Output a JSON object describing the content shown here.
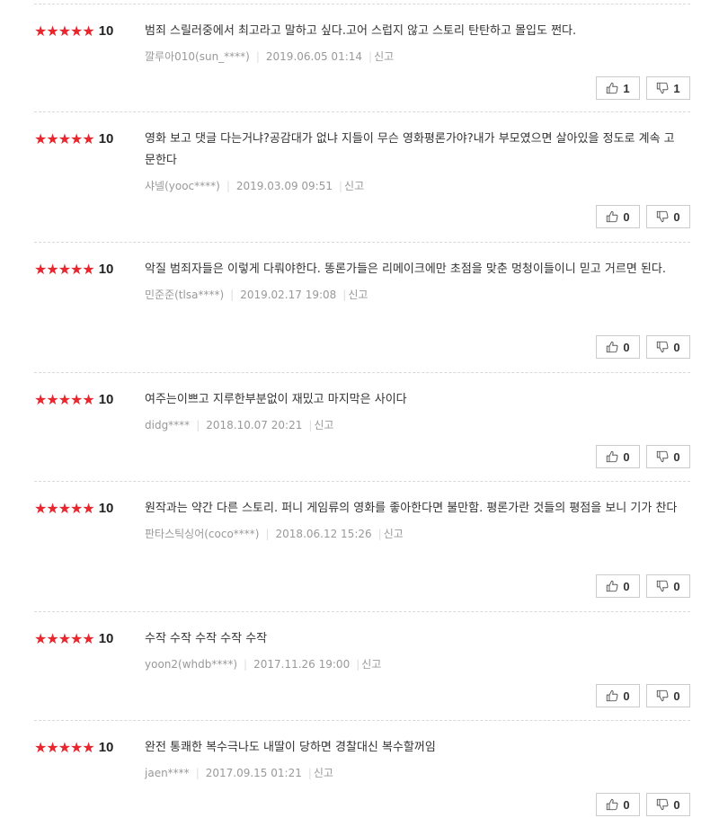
{
  "reviews": [
    {
      "stars": "★★★★★",
      "score": "10",
      "text": "범죄 스릴러중에서 최고라고 말하고 싶다.고어 스럽지 않고 스토리 탄탄하고 몰입도 쩐다.",
      "author": "깔루아010(sun_****)",
      "date": "2019.06.05 01:14",
      "report": "신고",
      "likes": "1",
      "dislikes": "1"
    },
    {
      "stars": "★★★★★",
      "score": "10",
      "text": "영화 보고 댓글 다는거냐?공감대가 없냐 지들이 무슨 영화평론가야?내가 부모였으면 살아있을 정도로 계속 고문한다",
      "author": "샤넬(yooc****)",
      "date": "2019.03.09 09:51",
      "report": "신고",
      "likes": "0",
      "dislikes": "0"
    },
    {
      "stars": "★★★★★",
      "score": "10",
      "text": "악질 범죄자들은 이렇게 다뤄야한다. 똥론가들은 리메이크에만 초점을 맞춘 멍청이들이니 믿고 거르면 된다.",
      "author": "민준준(tlsa****)",
      "date": "2019.02.17 19:08",
      "report": "신고",
      "likes": "0",
      "dislikes": "0"
    },
    {
      "stars": "★★★★★",
      "score": "10",
      "text": "여주는이쁘고 지루한부분없이 재밌고 마지막은 사이다",
      "author": "didg****",
      "date": "2018.10.07 20:21",
      "report": "신고",
      "likes": "0",
      "dislikes": "0"
    },
    {
      "stars": "★★★★★",
      "score": "10",
      "text": "원작과는 약간 다른 스토리. 퍼니 게임류의 영화를 좋아한다면 불만함. 평론가란 것들의 평점을 보니 기가 찬다",
      "author": "판타스틱싱어(coco****)",
      "date": "2018.06.12 15:26",
      "report": "신고",
      "likes": "0",
      "dislikes": "0"
    },
    {
      "stars": "★★★★★",
      "score": "10",
      "text": "수작 수작 수작 수작 수작",
      "author": "yoon2(whdb****)",
      "date": "2017.11.26 19:00",
      "report": "신고",
      "likes": "0",
      "dislikes": "0"
    },
    {
      "stars": "★★★★★",
      "score": "10",
      "text": "완전 통쾌한 복수극나도 내딸이 당하면 경찰대신 복수할꺼임",
      "author": "jaen****",
      "date": "2017.09.15 01:21",
      "report": "신고",
      "likes": "0",
      "dislikes": "0"
    }
  ],
  "icons": {
    "like": "thumbs-up-icon",
    "dislike": "thumbs-down-icon"
  },
  "colors": {
    "star": "#e7272d",
    "border": "#cccccc",
    "meta": "#999999"
  }
}
